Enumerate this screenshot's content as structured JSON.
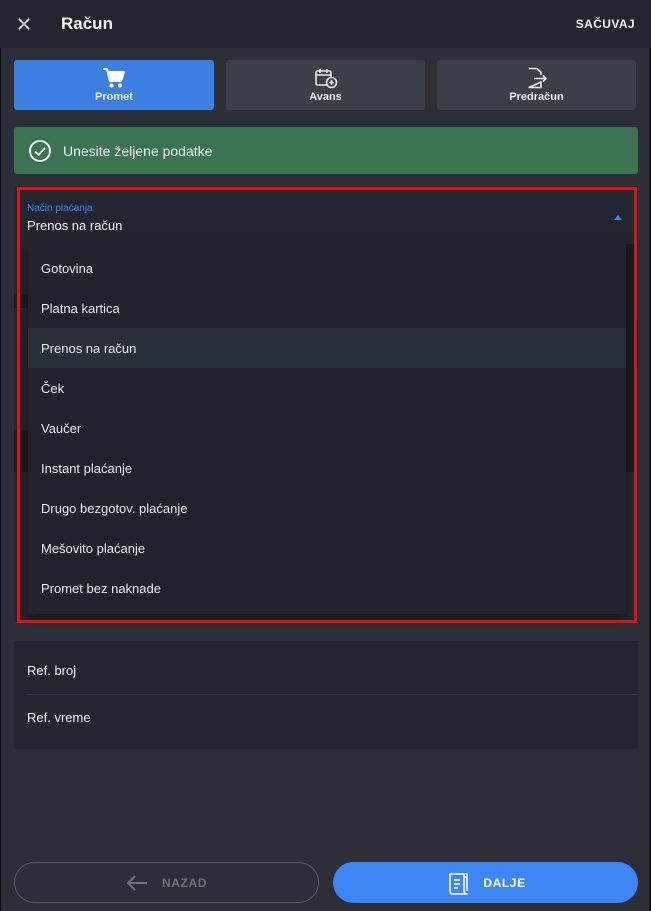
{
  "header": {
    "title": "Račun",
    "save_label": "SAČUVAJ"
  },
  "tabs": [
    {
      "label": "Promet",
      "icon": "cart-icon",
      "active": true
    },
    {
      "label": "Avans",
      "icon": "calendar-add-icon",
      "active": false
    },
    {
      "label": "Predračun",
      "icon": "document-export-icon",
      "active": false
    }
  ],
  "alert": {
    "text": "Unesite željene podatke",
    "color": "#3c7353"
  },
  "payment": {
    "label": "Način plaćanja",
    "value": "Prenos na račun",
    "options": [
      "Gotovina",
      "Platna kartica",
      "Prenos na račun",
      "Ček",
      "Vaučer",
      "Instant plaćanje",
      "Drugo bezgotov. plaćanje",
      "Mešovito plaćanje",
      "Promet bez naknade"
    ]
  },
  "ref": {
    "number_label": "Ref. broj",
    "time_label": "Ref. vreme"
  },
  "footer": {
    "back_label": "NAZAD",
    "next_label": "DALJE"
  },
  "colors": {
    "accent": "#3d86f5",
    "active_tab": "#3d7fe0",
    "highlight_border": "#e31212",
    "background": "#2c2f38"
  }
}
